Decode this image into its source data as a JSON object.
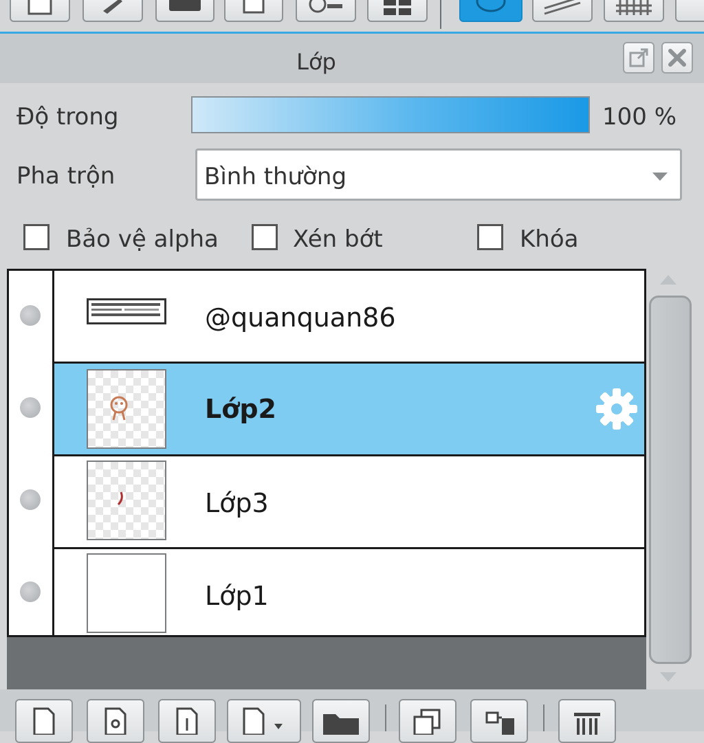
{
  "panel": {
    "title": "Lớp"
  },
  "opacity": {
    "label": "Độ trong",
    "value": 100,
    "display": "100 %"
  },
  "blend": {
    "label": "Pha trộn",
    "selected": "Bình thường"
  },
  "checkboxes": [
    {
      "label": "Bảo vệ alpha",
      "checked": false
    },
    {
      "label": "Xén bớt",
      "checked": false
    },
    {
      "label": "Khóa",
      "checked": false
    }
  ],
  "layers": [
    {
      "name": "@quanquan86",
      "selected": false,
      "thumbnail": "text-strip"
    },
    {
      "name": "Lớp2",
      "selected": true,
      "thumbnail": "sketch-face"
    },
    {
      "name": "Lớp3",
      "selected": false,
      "thumbnail": "sketch-mark"
    },
    {
      "name": "Lớp1",
      "selected": false,
      "thumbnail": "blank"
    }
  ],
  "icons": {
    "header": [
      "popout-icon",
      "close-icon"
    ],
    "top_toolbar": [
      "doc-icon",
      "pen-icon",
      "comment-icon",
      "page-icon",
      "timer-icon",
      "grid-icon",
      "layer-icon",
      "ruler-icon",
      "hatch-icon"
    ],
    "bottom_toolbar": [
      "new-layer-icon",
      "new-layer-8-icon",
      "new-layer-1-icon",
      "new-layer-menu-icon",
      "folder-icon",
      "duplicate-icon",
      "merge-icon",
      "trash-icon"
    ],
    "selected_layer": "gear-icon"
  },
  "colors": {
    "accent": "#1e9be0",
    "selection": "#7fccf3"
  }
}
